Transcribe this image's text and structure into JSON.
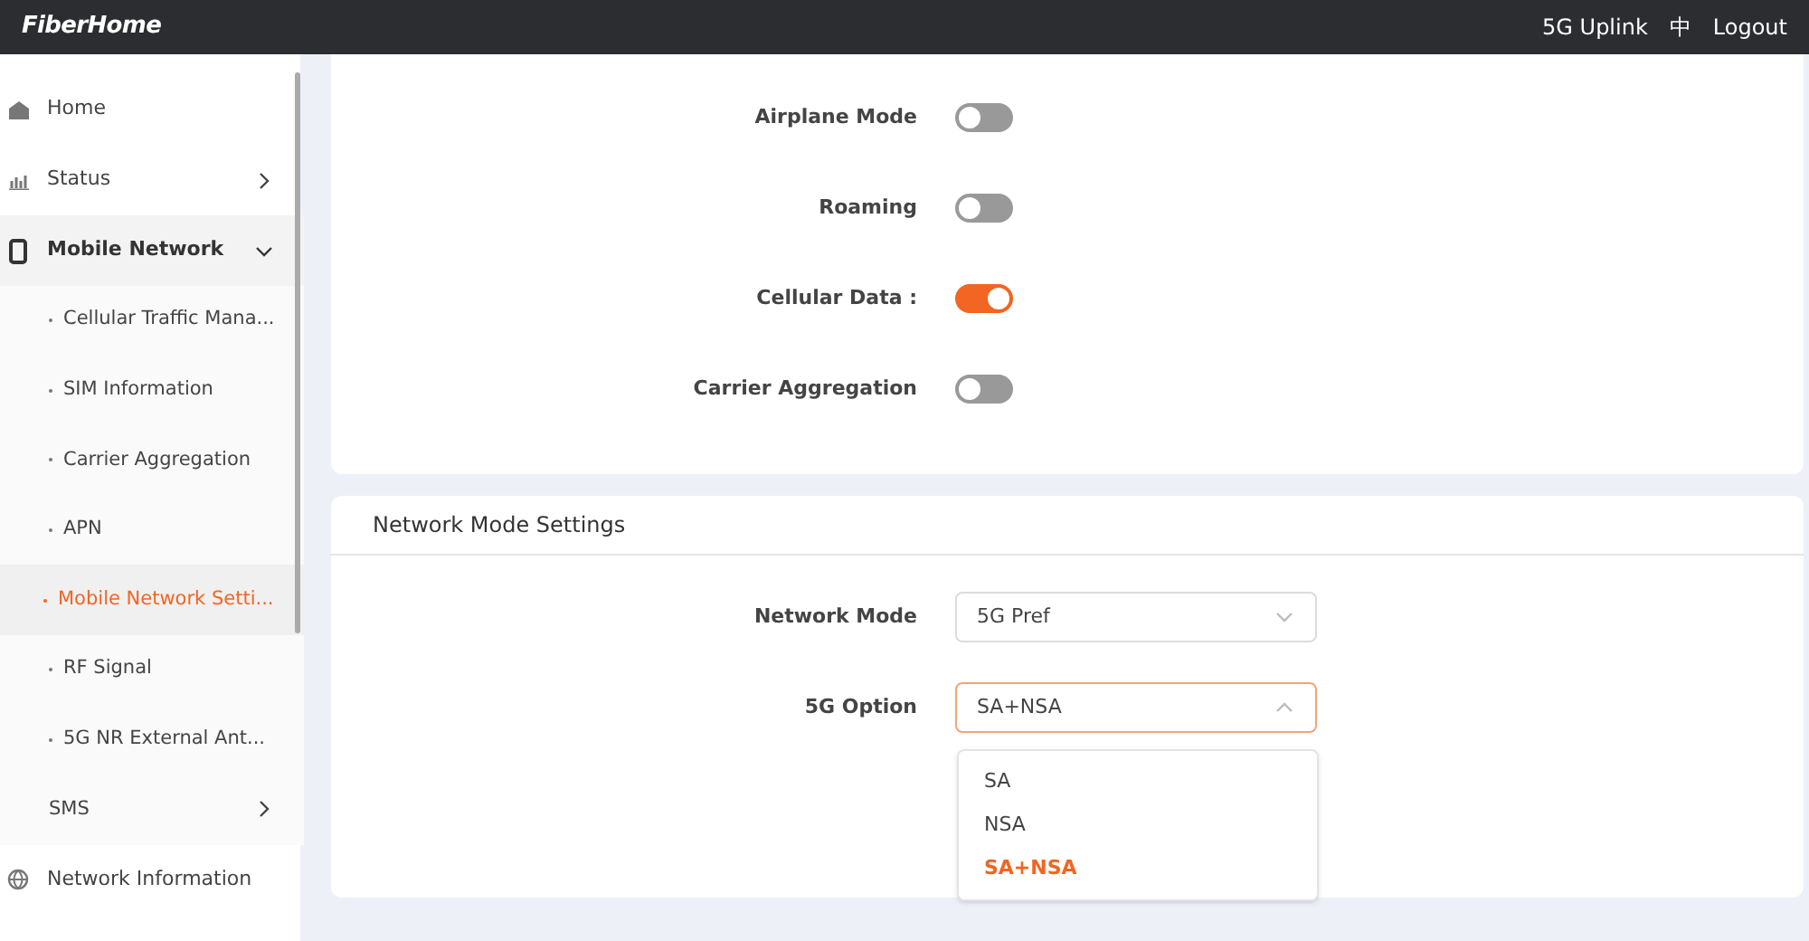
{
  "header": {
    "logo": "FiberHome",
    "links": [
      "5G Uplink",
      "中",
      "Logout"
    ]
  },
  "sidebar": {
    "items": [
      {
        "label": "Home",
        "kind": "page"
      },
      {
        "label": "Status",
        "kind": "group",
        "expanded": false
      },
      {
        "label": "Mobile Network",
        "kind": "group",
        "expanded": true,
        "children": [
          {
            "label": "Cellular Traffic Mana...",
            "kind": "page",
            "selected": false
          },
          {
            "label": "SIM Information",
            "kind": "page",
            "selected": false
          },
          {
            "label": "Carrier Aggregation",
            "kind": "page",
            "selected": false
          },
          {
            "label": "APN",
            "kind": "page",
            "selected": false
          },
          {
            "label": "Mobile Network Setti...",
            "kind": "page",
            "selected": true
          },
          {
            "label": "RF Signal",
            "kind": "page",
            "selected": false
          },
          {
            "label": "5G NR External Ant...",
            "kind": "page",
            "selected": false
          },
          {
            "label": "SMS",
            "kind": "group",
            "selected": false,
            "expanded": false
          }
        ]
      },
      {
        "label": "Network Information",
        "kind": "page"
      }
    ]
  },
  "switches": [
    {
      "label": "Airplane Mode",
      "on": false
    },
    {
      "label": "Roaming",
      "on": false
    },
    {
      "label": "Cellular Data :",
      "on": true
    },
    {
      "label": "Carrier Aggregation",
      "on": false
    }
  ],
  "network_mode": {
    "title": "Network Mode Settings",
    "fields": [
      {
        "label": "Network Mode",
        "value": "5G Pref",
        "open": false
      },
      {
        "label": "5G Option",
        "value": "SA+NSA",
        "open": true,
        "options": [
          {
            "label": "SA",
            "selected": false
          },
          {
            "label": "NSA",
            "selected": false
          },
          {
            "label": "SA+NSA",
            "selected": true
          }
        ]
      }
    ]
  }
}
